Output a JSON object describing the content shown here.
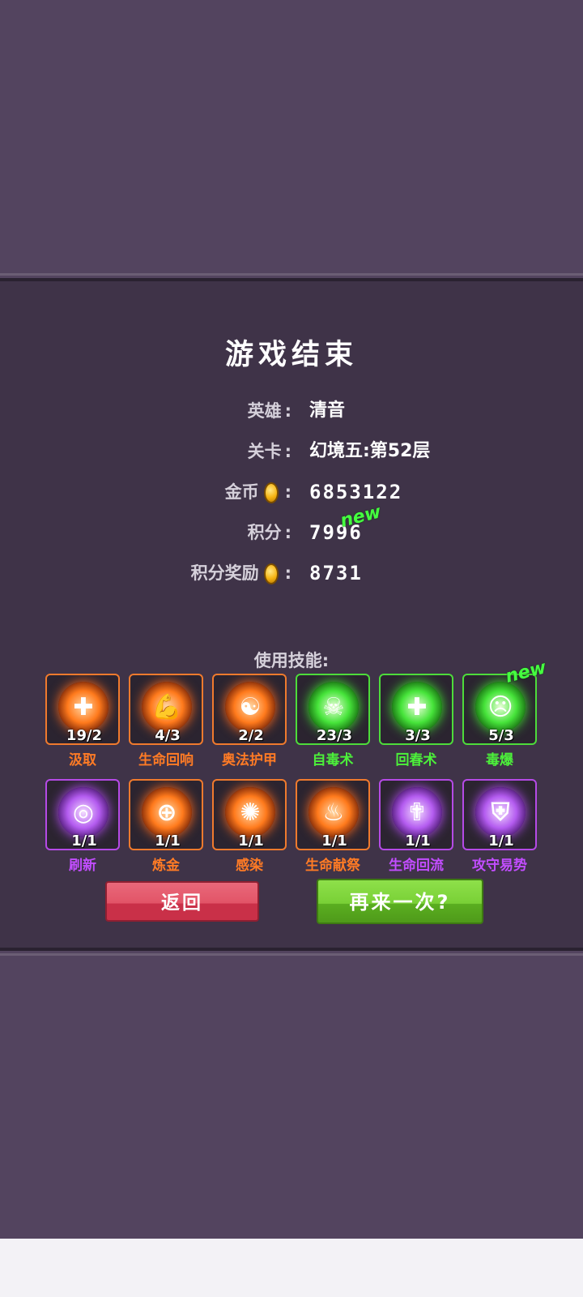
{
  "title": "游戏结束",
  "info": {
    "hero_label": "英雄",
    "hero_value": "清音",
    "stage_label": "关卡",
    "stage_value": "幻境五:第52层",
    "gold_label": "金币",
    "gold_value": "6853122",
    "score_label": "积分",
    "score_value": "7996",
    "score_new": "new",
    "reward_label": "积分奖励",
    "reward_value": "8731",
    "colon": ":"
  },
  "skills_heading": "使用技能:",
  "skills_new": "new",
  "skills": [
    {
      "name": "汲取",
      "count": "19/2",
      "color": "orange",
      "icon": "cross-emblem-icon",
      "glyph": "✚"
    },
    {
      "name": "生命回响",
      "count": "4/3",
      "color": "orange",
      "icon": "flexed-arm-icon",
      "glyph": "💪"
    },
    {
      "name": "奥法护甲",
      "count": "2/2",
      "color": "orange",
      "icon": "meditation-figure-icon",
      "glyph": "☯"
    },
    {
      "name": "自毒术",
      "count": "23/3",
      "color": "green",
      "icon": "skull-icon",
      "glyph": "☠"
    },
    {
      "name": "回春术",
      "count": "3/3",
      "color": "green",
      "icon": "heal-blob-icon",
      "glyph": "✚"
    },
    {
      "name": "毒爆",
      "count": "5/3",
      "color": "green",
      "icon": "angry-face-icon",
      "glyph": "☹"
    },
    {
      "name": "刷新",
      "count": "1/1",
      "color": "purple",
      "icon": "swirl-icon",
      "glyph": "◎"
    },
    {
      "name": "炼金",
      "count": "1/1",
      "color": "orange",
      "icon": "target-cauldron-icon",
      "glyph": "⊕"
    },
    {
      "name": "感染",
      "count": "1/1",
      "color": "orange",
      "icon": "splash-icon",
      "glyph": "✺"
    },
    {
      "name": "生命献祭",
      "count": "1/1",
      "color": "orange",
      "icon": "flame-bowl-icon",
      "glyph": "♨"
    },
    {
      "name": "生命回流",
      "count": "1/1",
      "color": "purple",
      "icon": "praying-figure-icon",
      "glyph": "✟"
    },
    {
      "name": "攻守易势",
      "count": "1/1",
      "color": "purple",
      "icon": "shield-icon",
      "glyph": "⛨"
    }
  ],
  "buttons": {
    "back": "返回",
    "retry": "再来一次?"
  },
  "colors": {
    "background": "#53445f",
    "panel": "#3f3348",
    "orange": "#ff7b25",
    "green": "#4cf03a",
    "purple": "#c24dff",
    "back_button": "#e25467",
    "retry_button": "#79d036"
  }
}
